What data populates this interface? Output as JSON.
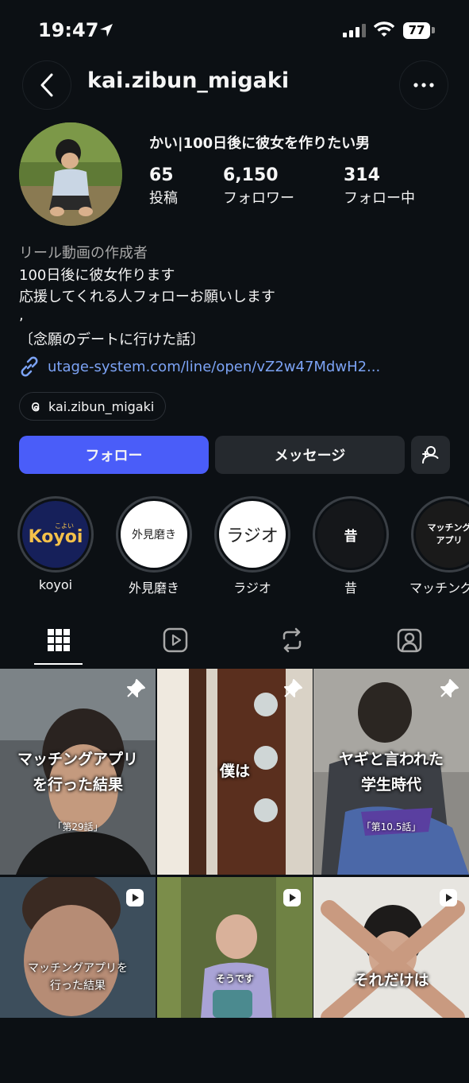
{
  "status_bar": {
    "time": "19:47",
    "battery": "77"
  },
  "header": {
    "username": "kai.zibun_migaki"
  },
  "profile": {
    "full_name": "かい|100日後に彼女を作りたい男",
    "stats": [
      {
        "num": "65",
        "label": "投稿"
      },
      {
        "num": "6,150",
        "label": "フォロワー"
      },
      {
        "num": "314",
        "label": "フォロー中"
      }
    ],
    "category": "リール動画の作成者",
    "bio": [
      "100日後に彼女作ります",
      "応援してくれる人フォローお願いします",
      ",",
      "〔念願のデートに行けた話〕"
    ],
    "link": "utage-system.com/line/open/vZ2w47MdwH2...",
    "threads_handle": "kai.zibun_migaki"
  },
  "actions": {
    "follow": "フォロー",
    "message": "メッセージ"
  },
  "highlights": [
    {
      "label": "koyoi",
      "cover_text": "Koyoi",
      "cover_small": "こよい"
    },
    {
      "label": "外見磨き",
      "cover_text": "外見磨き"
    },
    {
      "label": "ラジオ",
      "cover_text": "ラジオ"
    },
    {
      "label": "昔",
      "cover_text": "昔"
    },
    {
      "label": "マッチング",
      "cover_text": "マッチング\nアプリ"
    }
  ],
  "tabs": [
    "grid-icon",
    "reels-icon",
    "reposts-icon",
    "tagged-icon"
  ],
  "grid": [
    {
      "title": "マッチングアプリ\nを行った結果",
      "sub": "「第29話」",
      "badge": "pin"
    },
    {
      "title": "僕は",
      "sub": "",
      "badge": "pin"
    },
    {
      "title": "ヤギと言われた\n学生時代",
      "sub": "「第10.5話」",
      "badge": "pin"
    },
    {
      "title": "マッチングアプリを\n行った結果",
      "sub": "",
      "badge": "reel"
    },
    {
      "title": "そうです",
      "sub": "",
      "badge": "reel"
    },
    {
      "title": "それだけは",
      "sub": "",
      "badge": "reel"
    }
  ],
  "colors": {
    "background": "#0c1014",
    "follow": "#4a5df9",
    "link": "#7ca3f5",
    "secondary_button": "#25292e"
  }
}
